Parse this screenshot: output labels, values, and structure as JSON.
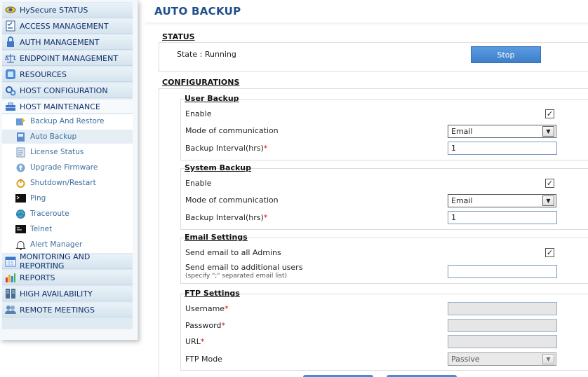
{
  "sidebar": {
    "items": [
      {
        "label": "HySecure STATUS",
        "icon": "eye-icon"
      },
      {
        "label": "ACCESS MANAGEMENT",
        "icon": "checklist-icon"
      },
      {
        "label": "AUTH MANAGEMENT",
        "icon": "lock-icon"
      },
      {
        "label": "ENDPOINT MANAGEMENT",
        "icon": "balance-icon"
      },
      {
        "label": "RESOURCES",
        "icon": "resources-icon"
      },
      {
        "label": "HOST CONFIGURATION",
        "icon": "gears-icon"
      },
      {
        "label": "HOST MAINTENANCE",
        "icon": "toolbox-icon"
      }
    ],
    "subitems": [
      {
        "label": "Backup And Restore",
        "icon": "backup-restore-icon"
      },
      {
        "label": "Auto Backup",
        "icon": "auto-backup-icon"
      },
      {
        "label": "License Status",
        "icon": "license-icon"
      },
      {
        "label": "Upgrade Firmware",
        "icon": "upgrade-icon"
      },
      {
        "label": "Shutdown/Restart",
        "icon": "shutdown-icon"
      },
      {
        "label": "Ping",
        "icon": "terminal-icon"
      },
      {
        "label": "Traceroute",
        "icon": "globe-icon"
      },
      {
        "label": "Telnet",
        "icon": "telnet-icon"
      },
      {
        "label": "Alert Manager",
        "icon": "bell-icon"
      }
    ],
    "items_after": [
      {
        "label": "MONITORING AND REPORTING",
        "icon": "calendar-icon"
      },
      {
        "label": "REPORTS",
        "icon": "bar-chart-icon"
      },
      {
        "label": "HIGH AVAILABILITY",
        "icon": "servers-icon"
      },
      {
        "label": "REMOTE MEETINGS",
        "icon": "meeting-icon"
      }
    ]
  },
  "page": {
    "title": "AUTO BACKUP"
  },
  "status": {
    "heading": "STATUS",
    "state_text": "State : Running",
    "stop_label": "Stop"
  },
  "config": {
    "heading": "CONFIGURATIONS",
    "user_backup": {
      "heading": "User Backup",
      "enable_label": "Enable",
      "enable_checked": "✓",
      "mode_label": "Mode of communication",
      "mode_value": "Email",
      "interval_label": "Backup Interval(hrs)",
      "interval_value": "1"
    },
    "system_backup": {
      "heading": "System Backup",
      "enable_label": "Enable",
      "enable_checked": "✓",
      "mode_label": "Mode of communication",
      "mode_value": "Email",
      "interval_label": "Backup Interval(hrs)",
      "interval_value": "1"
    },
    "email_settings": {
      "heading": "Email Settings",
      "send_all_label": "Send email to all Admins",
      "send_all_checked": "✓",
      "additional_label": "Send email to additional users",
      "additional_hint": "(specify \";\" separated email list)",
      "additional_value": ""
    },
    "ftp_settings": {
      "heading": "FTP Settings",
      "username_label": "Username",
      "password_label": "Password",
      "url_label": "URL",
      "mode_label": "FTP Mode",
      "mode_value": "Passive"
    },
    "required_mark": "*"
  },
  "colors": {
    "accent": "#3e7fcb",
    "title": "#1f4f8a",
    "sidebar_text": "#10306a",
    "submenu_text": "#3e6f9e"
  }
}
